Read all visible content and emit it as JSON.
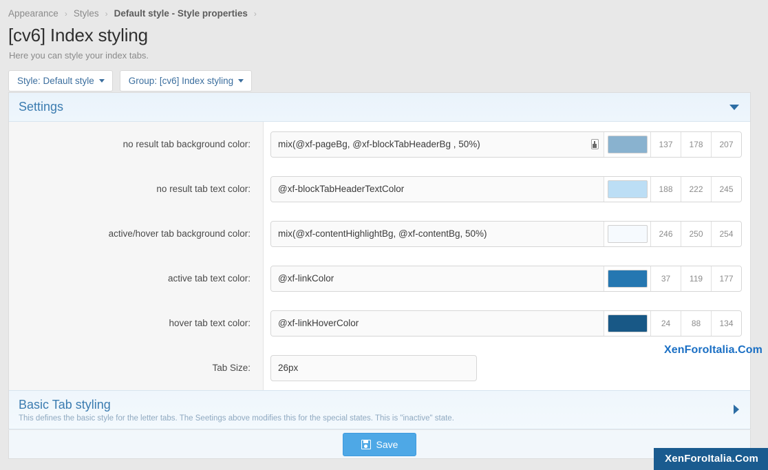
{
  "breadcrumb": {
    "items": [
      {
        "label": "Appearance",
        "strong": false
      },
      {
        "label": "Styles",
        "strong": false
      },
      {
        "label": "Default style - Style properties",
        "strong": true
      }
    ],
    "separator": "›"
  },
  "header": {
    "title": "[cv6] Index styling",
    "subtitle": "Here you can style your index tabs."
  },
  "selectors": {
    "style": "Style: Default style",
    "group": "Group: [cv6] Index styling"
  },
  "settings_section": {
    "title": "Settings",
    "collapse_icon": "chevron-down-icon"
  },
  "rows": [
    {
      "label": "no result tab background color:",
      "value": "mix(@xf-pageBg, @xf-blockTabHeaderBg , 50%)",
      "has_picker": true,
      "swatch": "#89b2cf",
      "r": "137",
      "g": "178",
      "b": "207"
    },
    {
      "label": "no result tab text color:",
      "value": "@xf-blockTabHeaderTextColor",
      "has_picker": false,
      "swatch": "#bcdef5",
      "r": "188",
      "g": "222",
      "b": "245"
    },
    {
      "label": "active/hover tab background color:",
      "value": "mix(@xf-contentHighlightBg, @xf-contentBg, 50%)",
      "has_picker": false,
      "swatch": "#f6fafe",
      "r": "246",
      "g": "250",
      "b": "254"
    },
    {
      "label": "active tab text color:",
      "value": "@xf-linkColor",
      "has_picker": false,
      "swatch": "#2577b1",
      "r": "37",
      "g": "119",
      "b": "177"
    },
    {
      "label": "hover tab text color:",
      "value": "@xf-linkHoverColor",
      "has_picker": false,
      "swatch": "#185886",
      "r": "24",
      "g": "88",
      "b": "134"
    }
  ],
  "tab_size_row": {
    "label": "Tab Size:",
    "value": "26px"
  },
  "basic_tab_section": {
    "title": "Basic Tab styling",
    "description": "This defines the basic style for the letter tabs. The Seetings above modifies this for the special states. This is \"inactive\" state.",
    "expand_icon": "chevron-right-icon"
  },
  "footer": {
    "save_label": "Save",
    "save_icon": "save-disk-icon"
  },
  "watermarks": {
    "inline": "XenForoItalia.Com",
    "badge": "XenForoItalia.Com"
  }
}
